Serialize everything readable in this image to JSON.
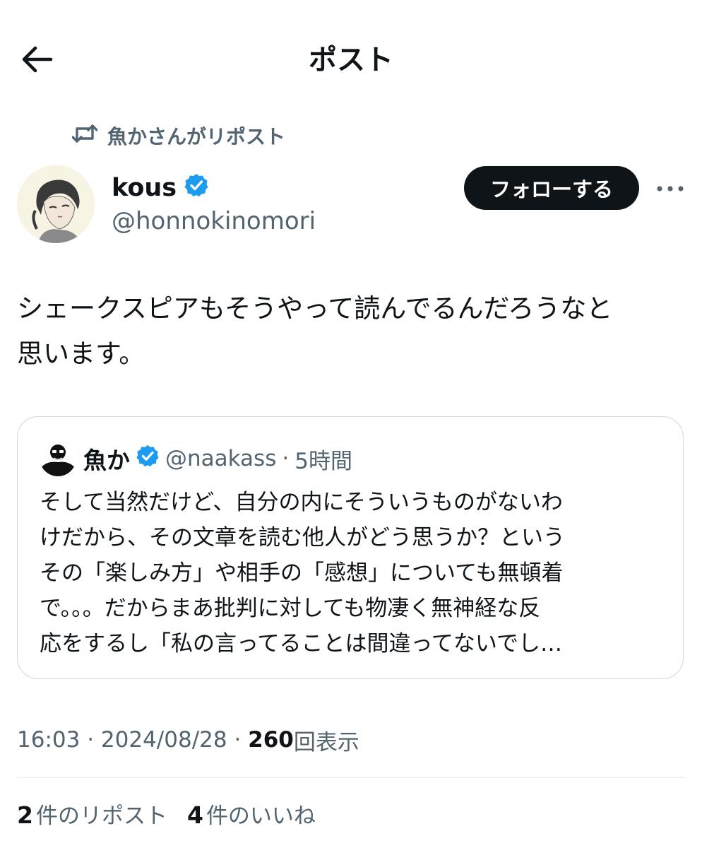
{
  "header": {
    "title": "ポスト",
    "back_icon": "arrow-left-icon"
  },
  "repost_context": {
    "icon": "repost-icon",
    "text": "魚かさんがリポスト"
  },
  "author": {
    "name": "kous",
    "verified": true,
    "handle": "@honnokinomori",
    "avatar": "avatar-illustration"
  },
  "actions": {
    "follow_label": "フォローする",
    "more_icon": "more-dots-icon"
  },
  "post": {
    "text": "シェークスピアもそうやって読んでるんだろうなと\n思います。"
  },
  "quote": {
    "name": "魚か",
    "verified": true,
    "handle": "@naakass",
    "separator": "·",
    "time": "5時間",
    "text": "そして当然だけど、自分の内にそういうものがないわ\nけだから、その文章を読む他人がどう思うか？という\nその「楽しみ方」や相手の「感想」についても無頓着\nで。。。だからまあ批判に対しても物凄く無神経な反\n応をするし「私の言ってることは間違ってないでし…"
  },
  "meta": {
    "time": "16:03",
    "sep1": " · ",
    "date": "2024/08/28",
    "sep2": " · ",
    "views": "260",
    "views_label": "回表示"
  },
  "stats": {
    "reposts_count": "2",
    "reposts_label": "件のリポスト",
    "likes_count": "4",
    "likes_label": "件のいいね"
  },
  "colors": {
    "text_primary": "#0f1419",
    "text_secondary": "#536471",
    "verified_blue": "#1d9bf0",
    "border": "#cfd9de"
  }
}
